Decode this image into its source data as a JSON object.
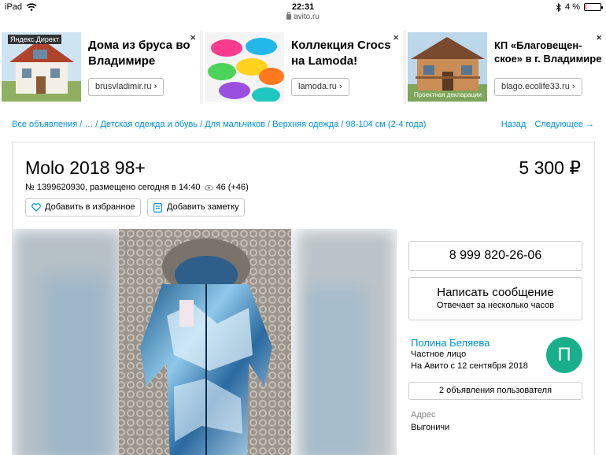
{
  "statusbar": {
    "device": "iPad",
    "time": "22:31",
    "url": "avito.ru",
    "battery": "4 %",
    "battery_level": 0.04
  },
  "ads": [
    {
      "label": "Яндекс.Директ",
      "text": "Дома из бруса во Владимире",
      "url": "brusvladimir.ru ›",
      "close": "×"
    },
    {
      "text": "Коллекция Crocs на Lamoda!",
      "url": "lamoda.ru ›",
      "close": "×"
    },
    {
      "text": "КП «Благовещен-ское» в г. Владимире",
      "url": "blago.ecolife33.ru ›",
      "close": "×",
      "caption": "Проектная декларации"
    }
  ],
  "breadcrumbs": {
    "items": [
      "Все объявления",
      "…",
      "Детская одежда и обувь",
      "Для мальчиков",
      "Верхняя одежда",
      "98-104 см (2-4 года)"
    ],
    "back": "Назад",
    "next": "Следующее →"
  },
  "listing": {
    "title": "Molo 2018 98+",
    "price": "5 300 ₽",
    "meta": "№ 1399620930, размещено сегодня в 14:40",
    "views": "46 (+46)",
    "fav_label": "Добавить в избранное",
    "note_label": "Добавить заметку"
  },
  "contact": {
    "phone": "8 999 820-26-06",
    "message_label": "Написать сообщение",
    "message_sub": "Отвечает за несколько часов",
    "seller_name": "Полина Беляева",
    "seller_type": "Частное лицо",
    "seller_since": "На Авито с 12 сентября 2018",
    "avatar_letter": "П",
    "user_ads": "2 объявления пользователя",
    "address_label": "Адрес",
    "address_value": "Выгоничи"
  },
  "colors": {
    "link": "#0091d9",
    "avatar": "#1aaf8b"
  }
}
